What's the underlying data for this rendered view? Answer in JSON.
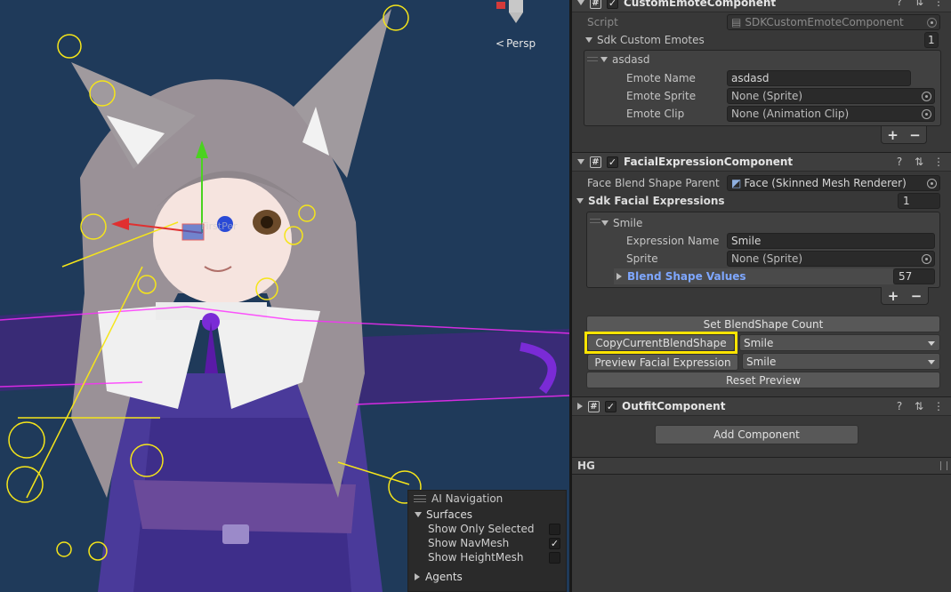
{
  "scene": {
    "persp_label": "Persp",
    "overlay_ghost_text": "FirstPer",
    "nav_overlay": {
      "title": "AI Navigation",
      "section": "Surfaces",
      "options": [
        {
          "label": "Show Only Selected",
          "checked": false
        },
        {
          "label": "Show NavMesh",
          "checked": true
        },
        {
          "label": "Show HeightMesh",
          "checked": false
        }
      ],
      "agents_label": "Agents"
    }
  },
  "inspector": {
    "custom_emote": {
      "title": "CustomEmoteComponent",
      "script_label": "Script",
      "script_value": "SDKCustomEmoteComponent",
      "list_label": "Sdk Custom Emotes",
      "list_count": "1",
      "element_name": "asdasd",
      "fields": {
        "emote_name_label": "Emote Name",
        "emote_name_value": "asdasd",
        "emote_sprite_label": "Emote Sprite",
        "emote_sprite_value": "None (Sprite)",
        "emote_clip_label": "Emote Clip",
        "emote_clip_value": "None (Animation Clip)"
      }
    },
    "facial": {
      "title": "FacialExpressionComponent",
      "parent_label": "Face Blend Shape Parent",
      "parent_value": "Face (Skinned Mesh Renderer)",
      "list_label": "Sdk Facial Expressions",
      "list_count": "1",
      "element_name": "Smile",
      "expression_name_label": "Expression Name",
      "expression_name_value": "Smile",
      "sprite_label": "Sprite",
      "sprite_value": "None (Sprite)",
      "blend_label": "Blend Shape Values",
      "blend_count": "57",
      "set_count_button": "Set BlendShape Count",
      "copy_button": "CopyCurrentBlendShape",
      "copy_dropdown": "Smile",
      "preview_button": "Preview Facial Expression",
      "preview_dropdown": "Smile",
      "reset_button": "Reset Preview"
    },
    "outfit": {
      "title": "OutfitComponent"
    },
    "add_component": "Add Component",
    "hg_label": "HG",
    "plus": "+",
    "minus": "−",
    "checkmark": "✓",
    "hash": "#",
    "header_icons": {
      "help": "?",
      "presets": "⇅",
      "menu": "⋮"
    }
  },
  "colors": {
    "scene_bg": "#1f3a5a",
    "highlight": "#ffe400",
    "gizmo_yellow": "#f5e51a",
    "purple": "#7a2bd6"
  }
}
